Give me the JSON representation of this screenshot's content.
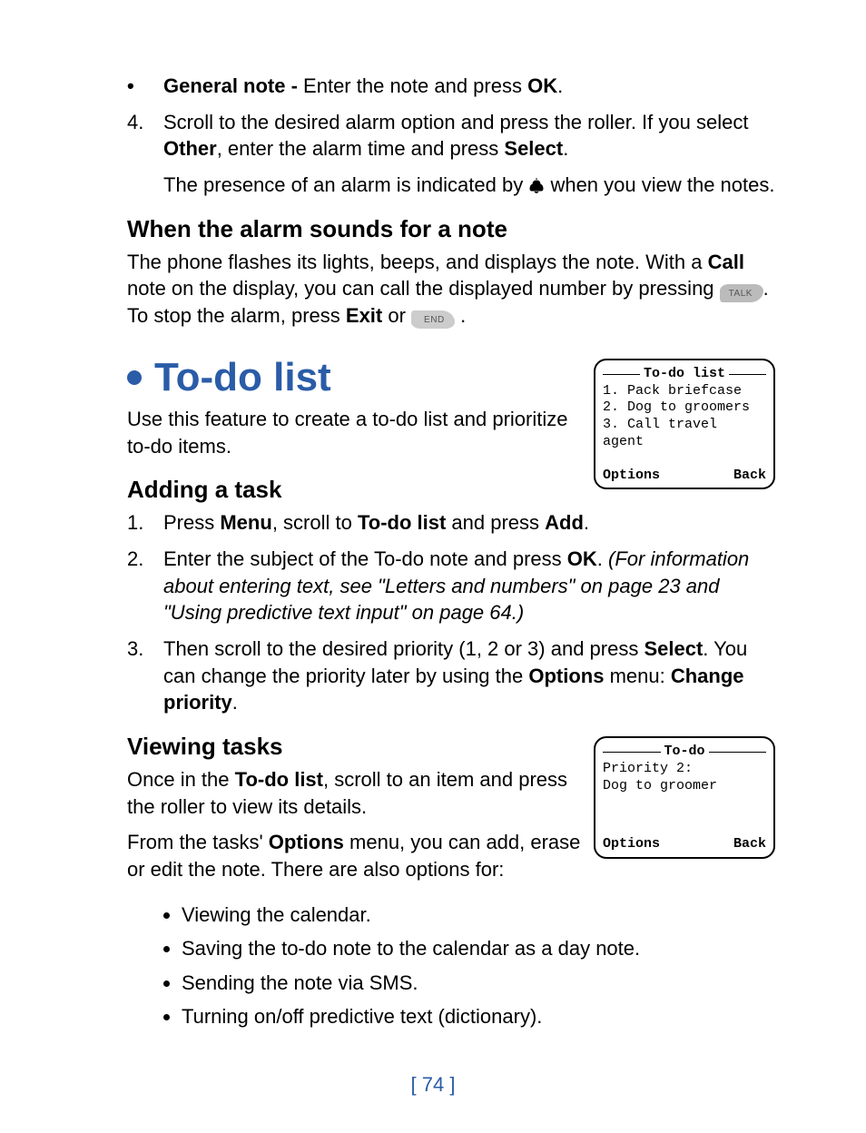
{
  "top_bullet": {
    "lead": "General note - ",
    "text": "Enter the note and press ",
    "ok": "OK",
    "tail": "."
  },
  "step4": {
    "num": "4.",
    "a": "Scroll to the desired alarm option and press the roller. If you select ",
    "other": "Other",
    "b": ", enter the alarm time and press ",
    "select": "Select",
    "c": ".",
    "presence_a": "The presence of an alarm is indicated by ",
    "presence_b": " when you view the notes."
  },
  "alarm_section": {
    "heading": "When the alarm sounds for a note",
    "p1_a": "The phone flashes its lights, beeps, and displays the note. With a ",
    "p1_call": "Call",
    "p1_b": " note on the display, you can call the displayed number by pressing ",
    "p1_c": ". To stop the alarm, press ",
    "p1_exit": "Exit",
    "p1_d": " or ",
    "p1_e": " ."
  },
  "todo_section": {
    "title": "To-do list",
    "intro": "Use this feature to create a to-do list and prioritize to-do items."
  },
  "screen1": {
    "title": "To-do list",
    "items": [
      "1.  Pack briefcase",
      "2.  Dog to groomers",
      "3.  Call travel agent"
    ],
    "left": "Options",
    "right": "Back"
  },
  "adding": {
    "heading": "Adding a task",
    "s1_num": "1.",
    "s1_a": "Press ",
    "s1_menu": "Menu",
    "s1_b": ", scroll to ",
    "s1_todo": "To-do list",
    "s1_c": " and press ",
    "s1_add": "Add",
    "s1_d": ".",
    "s2_num": "2.",
    "s2_a": "Enter the subject of the To-do note and press ",
    "s2_ok": "OK",
    "s2_b": ". ",
    "s2_italic": "(For information about entering text, see \"Letters and numbers\" on page 23 and \"Using predictive text input\" on page 64.)",
    "s3_num": "3.",
    "s3_a": "Then scroll to the desired priority (1, 2 or 3) and press ",
    "s3_select": "Select",
    "s3_b": ". You can change the priority later by using the ",
    "s3_options": "Options",
    "s3_c": " menu: ",
    "s3_change": "Change priority",
    "s3_d": "."
  },
  "viewing": {
    "heading": "Viewing tasks",
    "p1_a": "Once in the ",
    "p1_todo": "To-do list",
    "p1_b": ", scroll to an item and press the roller to view its details.",
    "p2_a": "From the tasks' ",
    "p2_options": "Options",
    "p2_b": " menu, you can add, erase or edit the note. There are also options for:",
    "opts": [
      "Viewing the calendar.",
      "Saving the to-do note to the calendar as a day note.",
      "Sending the note via SMS.",
      "Turning on/off predictive text (dictionary)."
    ]
  },
  "screen2": {
    "title": "To-do",
    "line1": "Priority 2:",
    "line2": "Dog to groomer",
    "left": "Options",
    "right": "Back"
  },
  "pagenum": "[ 74 ]"
}
